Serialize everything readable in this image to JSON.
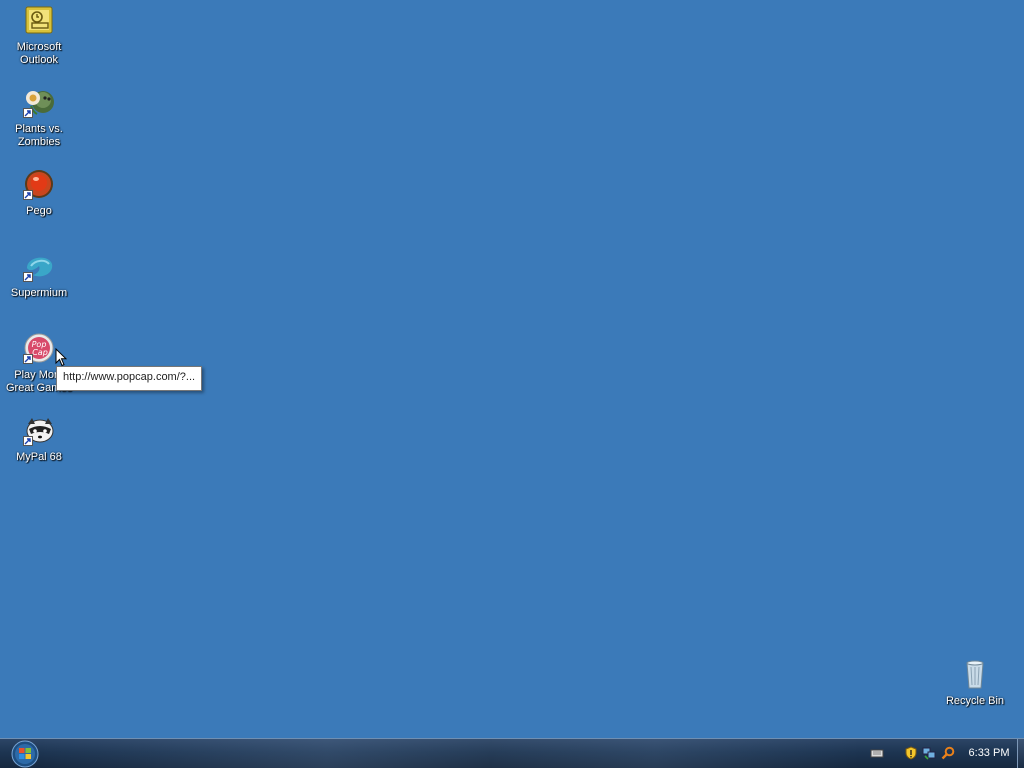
{
  "desktop": {
    "icons": [
      {
        "label": "Microsoft\nOutlook",
        "icon": "outlook-icon",
        "shortcut": false
      },
      {
        "label": "Plants vs.\nZombies",
        "icon": "plants-vs-zombies-icon",
        "shortcut": true
      },
      {
        "label": "Pego",
        "icon": "pego-icon",
        "shortcut": true
      },
      {
        "label": "Supermium",
        "icon": "supermium-icon",
        "shortcut": true
      },
      {
        "label": "Play More\nGreat Games",
        "icon": "popcap-icon",
        "shortcut": true
      },
      {
        "label": "MyPal 68",
        "icon": "mypal-icon",
        "shortcut": true
      },
      {
        "label": "Recycle Bin",
        "icon": "recycle-bin-icon",
        "shortcut": false
      }
    ],
    "tooltip": "http://www.popcap.com/?..."
  },
  "taskbar": {
    "start_icon": "windows-start-orb",
    "tray_icons": [
      "keyboard-icon",
      "security-shield-icon",
      "network-icon",
      "search-icon"
    ],
    "clock": "6:33 PM"
  },
  "colors": {
    "desktop_bg": "#3b7ab9",
    "taskbar": "#1d3552"
  }
}
